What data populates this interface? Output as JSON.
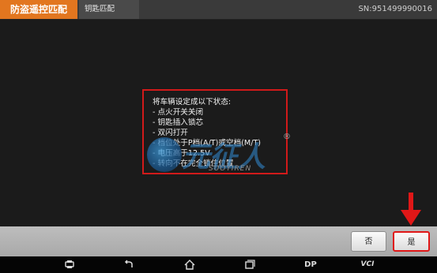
{
  "header": {
    "app_title": "防盗遥控匹配",
    "subtitle": "钥匙匹配",
    "serial": "SN:951499990016"
  },
  "dialog": {
    "lines": [
      "将车辆设定成以下状态:",
      "- 点火开关关闭",
      "- 钥匙插入锁芯",
      "- 双闪打开",
      "- 档位处于P档(A/T)或空档(M/T)",
      "- 电压高于12.5V",
      "- 转向不在完全锁住位置"
    ]
  },
  "watermark": {
    "text": "元征人",
    "sub": "SUOYIREN",
    "reg": "®"
  },
  "actions": {
    "no_label": "否",
    "yes_label": "是"
  },
  "navbar": {
    "dp_label": "DP",
    "vci_label": "VCI"
  },
  "colors": {
    "accent": "#e2761f",
    "highlight": "#d11a1a"
  }
}
